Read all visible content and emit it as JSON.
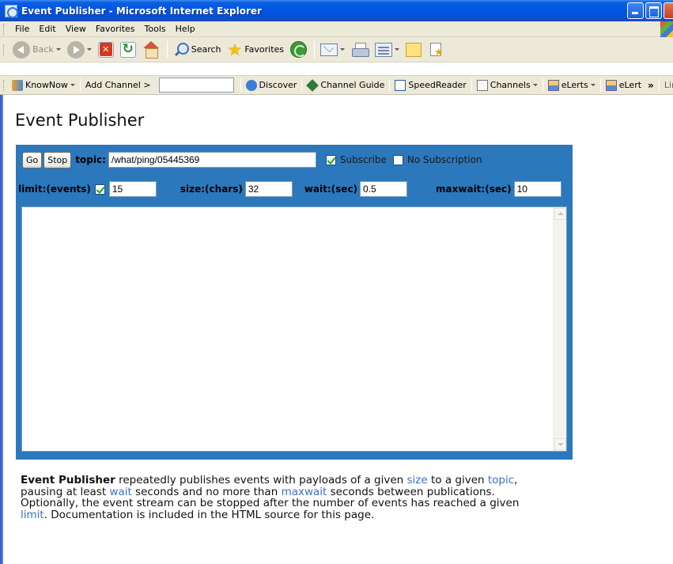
{
  "window": {
    "title": "Event Publisher - Microsoft Internet Explorer"
  },
  "menu": [
    "File",
    "Edit",
    "View",
    "Favorites",
    "Tools",
    "Help"
  ],
  "toolbar": {
    "back_label": "Back",
    "search_label": "Search",
    "favorites_label": "Favorites"
  },
  "links_bar": {
    "knownow_label": "KnowNow",
    "add_channel_label": "Add Channel >",
    "channel_input_value": "",
    "discover_label": "Discover",
    "channel_guide_label": "Channel Guide",
    "speedreader_label": "SpeedReader",
    "channels_label": "Channels",
    "elerts_label": "eLerts",
    "elert_label": "eLert",
    "chevron": "»",
    "links_label": "Links"
  },
  "page": {
    "title": "Event Publisher",
    "go_button": "Go",
    "stop_button": "Stop",
    "topic_label": "topic:",
    "topic_value": "/what/ping/05445369",
    "subscribe_label": "Subscribe",
    "subscribe_checked": true,
    "no_subscription_label": "No Subscription",
    "no_subscription_checked": false,
    "limit_label": "limit:(events)",
    "limit_checked": true,
    "limit_value": "15",
    "size_label": "size:(chars)",
    "size_value": "32",
    "wait_label": "wait:(sec)",
    "wait_value": "0.5",
    "maxwait_label": "maxwait:(sec)",
    "maxwait_value": "10",
    "log_text": ""
  },
  "description": {
    "app_name": "Event Publisher",
    "t1": " repeatedly publishes events with payloads of a given ",
    "k_size": "size",
    "t2": " to a given ",
    "k_topic": "topic",
    "t3": ", pausing at least ",
    "k_wait": "wait",
    "t4": " seconds and no more than ",
    "k_maxwait": "maxwait",
    "t5": " seconds between publications. Optionally, the event stream can be stopped after the number of events has reached a given ",
    "k_limit": "limit",
    "t6": ". Documentation is included in the HTML source for this page."
  },
  "colors": {
    "panel": "#2b78bd",
    "link": "#3f6fc8",
    "titlebar": "#0054e3"
  }
}
